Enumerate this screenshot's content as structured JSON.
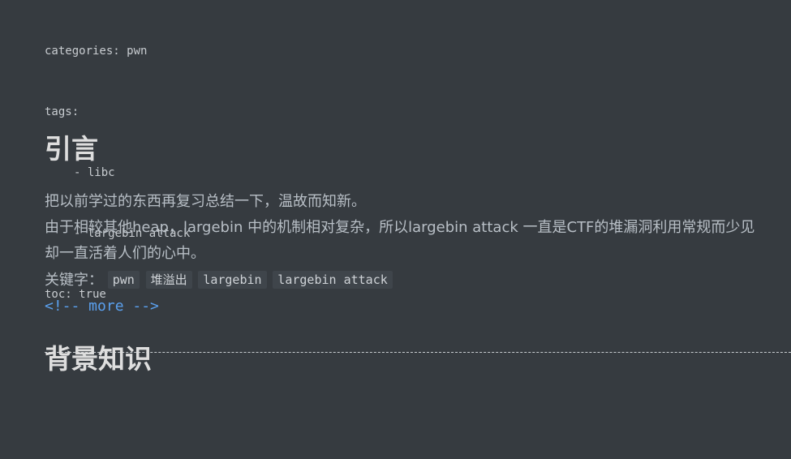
{
  "front_matter": {
    "categories_line": "categories: pwn",
    "tags_line": "tags:",
    "tag_items": [
      "- libc",
      "- largebin attack"
    ],
    "toc_line": "toc: true"
  },
  "intro": {
    "heading": "引言",
    "line1": "把以前学过的东西再复习总结一下，温故而知新。",
    "line2": "由于相较其他heap，largebin 中的机制相对复杂，所以largebin attack 一直是CTF的堆漏洞利用常规而少见",
    "line3": "却一直活着人们的心中。",
    "keywords_label": "关键字：",
    "keywords": [
      "pwn",
      "堆溢出",
      "largebin",
      "largebin attack"
    ]
  },
  "more_comment": "<!-- more -->",
  "background": {
    "heading": "背景知识"
  }
}
